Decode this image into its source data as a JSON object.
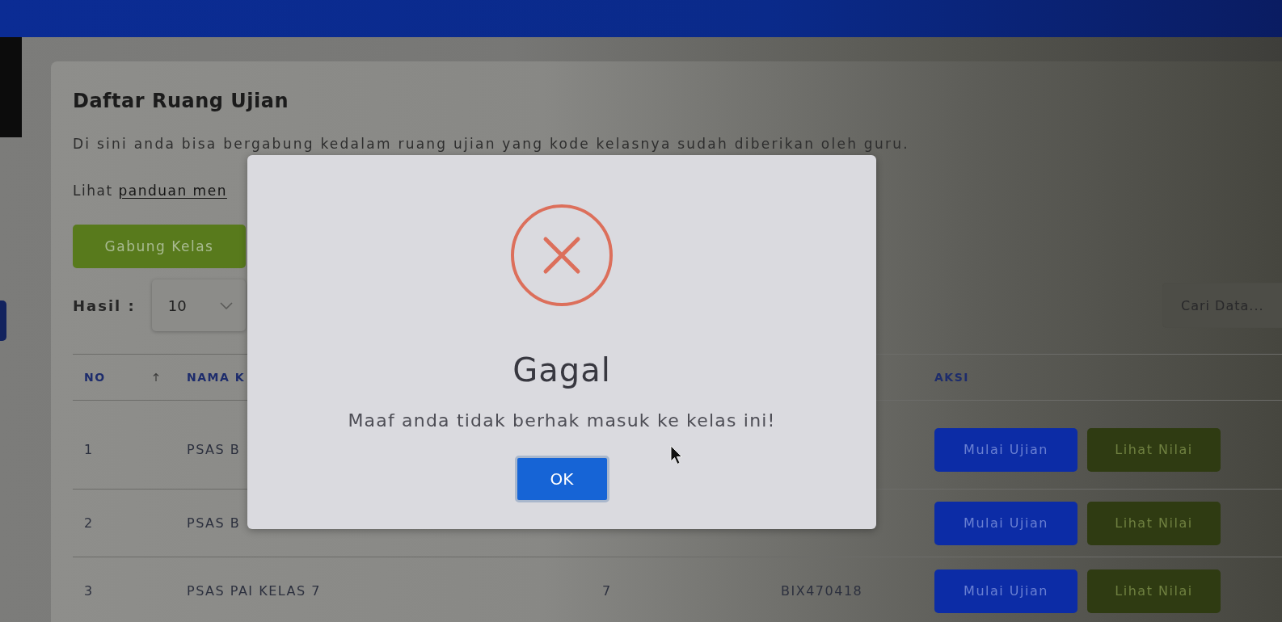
{
  "page": {
    "title": "Daftar Ruang Ujian",
    "description": "Di sini anda bisa bergabung kedalam ruang ujian yang kode kelasnya sudah diberikan oleh guru.",
    "guide": {
      "text": "Lihat",
      "link": "panduan men"
    },
    "join_button": "Gabung Kelas"
  },
  "controls": {
    "page_size": {
      "label": "Hasil :",
      "value": "10"
    },
    "search": {
      "placeholder": "Cari Data..."
    }
  },
  "table": {
    "columns": [
      {
        "label": "NO",
        "kind": "no",
        "sorted": true
      },
      {
        "label": "NAMA K",
        "kind": "name",
        "sorted": false
      },
      {
        "label": "AKSI",
        "kind": "actions",
        "sorted": false
      }
    ],
    "rows": [
      {
        "no": "1",
        "name": "PSAS B",
        "actions": [
          {
            "label": "Mulai Ujian",
            "kind": "start"
          },
          {
            "label": "Lihat Nilai",
            "kind": "view"
          }
        ]
      },
      {
        "no": "2",
        "name": "PSAS B",
        "actions": [
          {
            "label": "Mulai Ujian",
            "kind": "start"
          },
          {
            "label": "Lihat Nilai",
            "kind": "view"
          }
        ]
      },
      {
        "no": "3",
        "name": "PSAS PAI KELAS 7",
        "column_3": "7",
        "column_4": "BIX470418",
        "actions": [
          {
            "label": "Mulai Ujian",
            "kind": "start"
          },
          {
            "label": "Lihat Nilai",
            "kind": "view"
          }
        ]
      }
    ]
  },
  "dialog": {
    "kind": "error",
    "title": "Gagal",
    "message": "Maaf anda tidak berhak masuk ke kelas ini!",
    "button": "OK"
  }
}
